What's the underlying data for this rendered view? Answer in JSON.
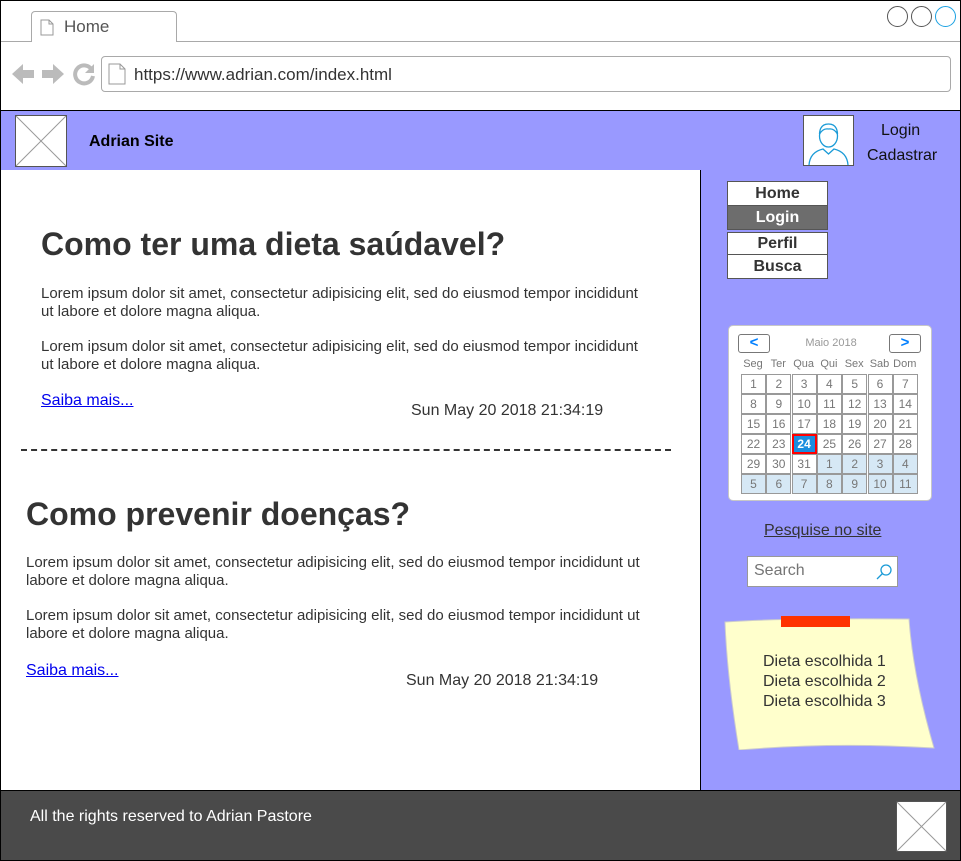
{
  "browser": {
    "tab_label": "Home",
    "url": "https://www.adrian.com/index.html",
    "icons": [
      "back-arrow-icon",
      "forward-arrow-icon",
      "reload-icon",
      "page-icon"
    ]
  },
  "header": {
    "site_title": "Adrian Site",
    "login": "Login",
    "register": "Cadastrar",
    "bg_color": "#9999ff"
  },
  "articles": [
    {
      "title": "Como ter uma dieta saúdavel?",
      "paragraphs": [
        "Lorem ipsum dolor sit amet, consectetur adipisicing elit, sed do eiusmod tempor incididunt ut labore et dolore magna aliqua.",
        "Lorem ipsum dolor sit amet, consectetur adipisicing elit, sed do eiusmod tempor incididunt ut labore et dolore magna aliqua."
      ],
      "more": "Saiba mais...",
      "date": "Sun May 20 2018 21:34:19"
    },
    {
      "title": "Como prevenir doenças?",
      "paragraphs": [
        "Lorem ipsum dolor sit amet, consectetur adipisicing elit, sed do eiusmod tempor incididunt ut labore et dolore magna aliqua.",
        "Lorem ipsum dolor sit amet, consectetur adipisicing elit, sed do eiusmod tempor incididunt ut labore et dolore magna aliqua."
      ],
      "more": "Saiba mais...",
      "date": "Sun May 20 2018 21:34:19"
    }
  ],
  "sidebar": {
    "menu": [
      {
        "label": "Home",
        "active": false
      },
      {
        "label": "Login",
        "active": true
      },
      {
        "label": "Perfil",
        "active": false
      },
      {
        "label": "Busca",
        "active": false
      }
    ],
    "calendar": {
      "month_label": "Maio 2018",
      "prev": "<",
      "next": ">",
      "weekdays": [
        "Seg",
        "Ter",
        "Qua",
        "Qui",
        "Sex",
        "Sab",
        "Dom"
      ],
      "weeks": [
        [
          "1",
          "2",
          "3",
          "4",
          "5",
          "6",
          "7"
        ],
        [
          "8",
          "9",
          "10",
          "11",
          "12",
          "13",
          "14"
        ],
        [
          "15",
          "16",
          "17",
          "18",
          "19",
          "20",
          "21"
        ],
        [
          "22",
          "23",
          "24",
          "25",
          "26",
          "27",
          "28"
        ],
        [
          "29",
          "30",
          "31",
          "1",
          "2",
          "3",
          "4"
        ],
        [
          "5",
          "6",
          "7",
          "8",
          "9",
          "10",
          "11"
        ]
      ],
      "selected": "24"
    },
    "search_label": "Pesquise no site",
    "search_placeholder": "Search",
    "sticky_note": [
      "Dieta escolhida 1",
      "Dieta escolhida 2",
      "Dieta escolhida 3"
    ],
    "sticky_color": "#ffffcc",
    "tape_color": "#ff3300"
  },
  "footer": {
    "text": "All the rights reserved to Adrian Pastore",
    "bg_color": "#4a4a4a"
  }
}
